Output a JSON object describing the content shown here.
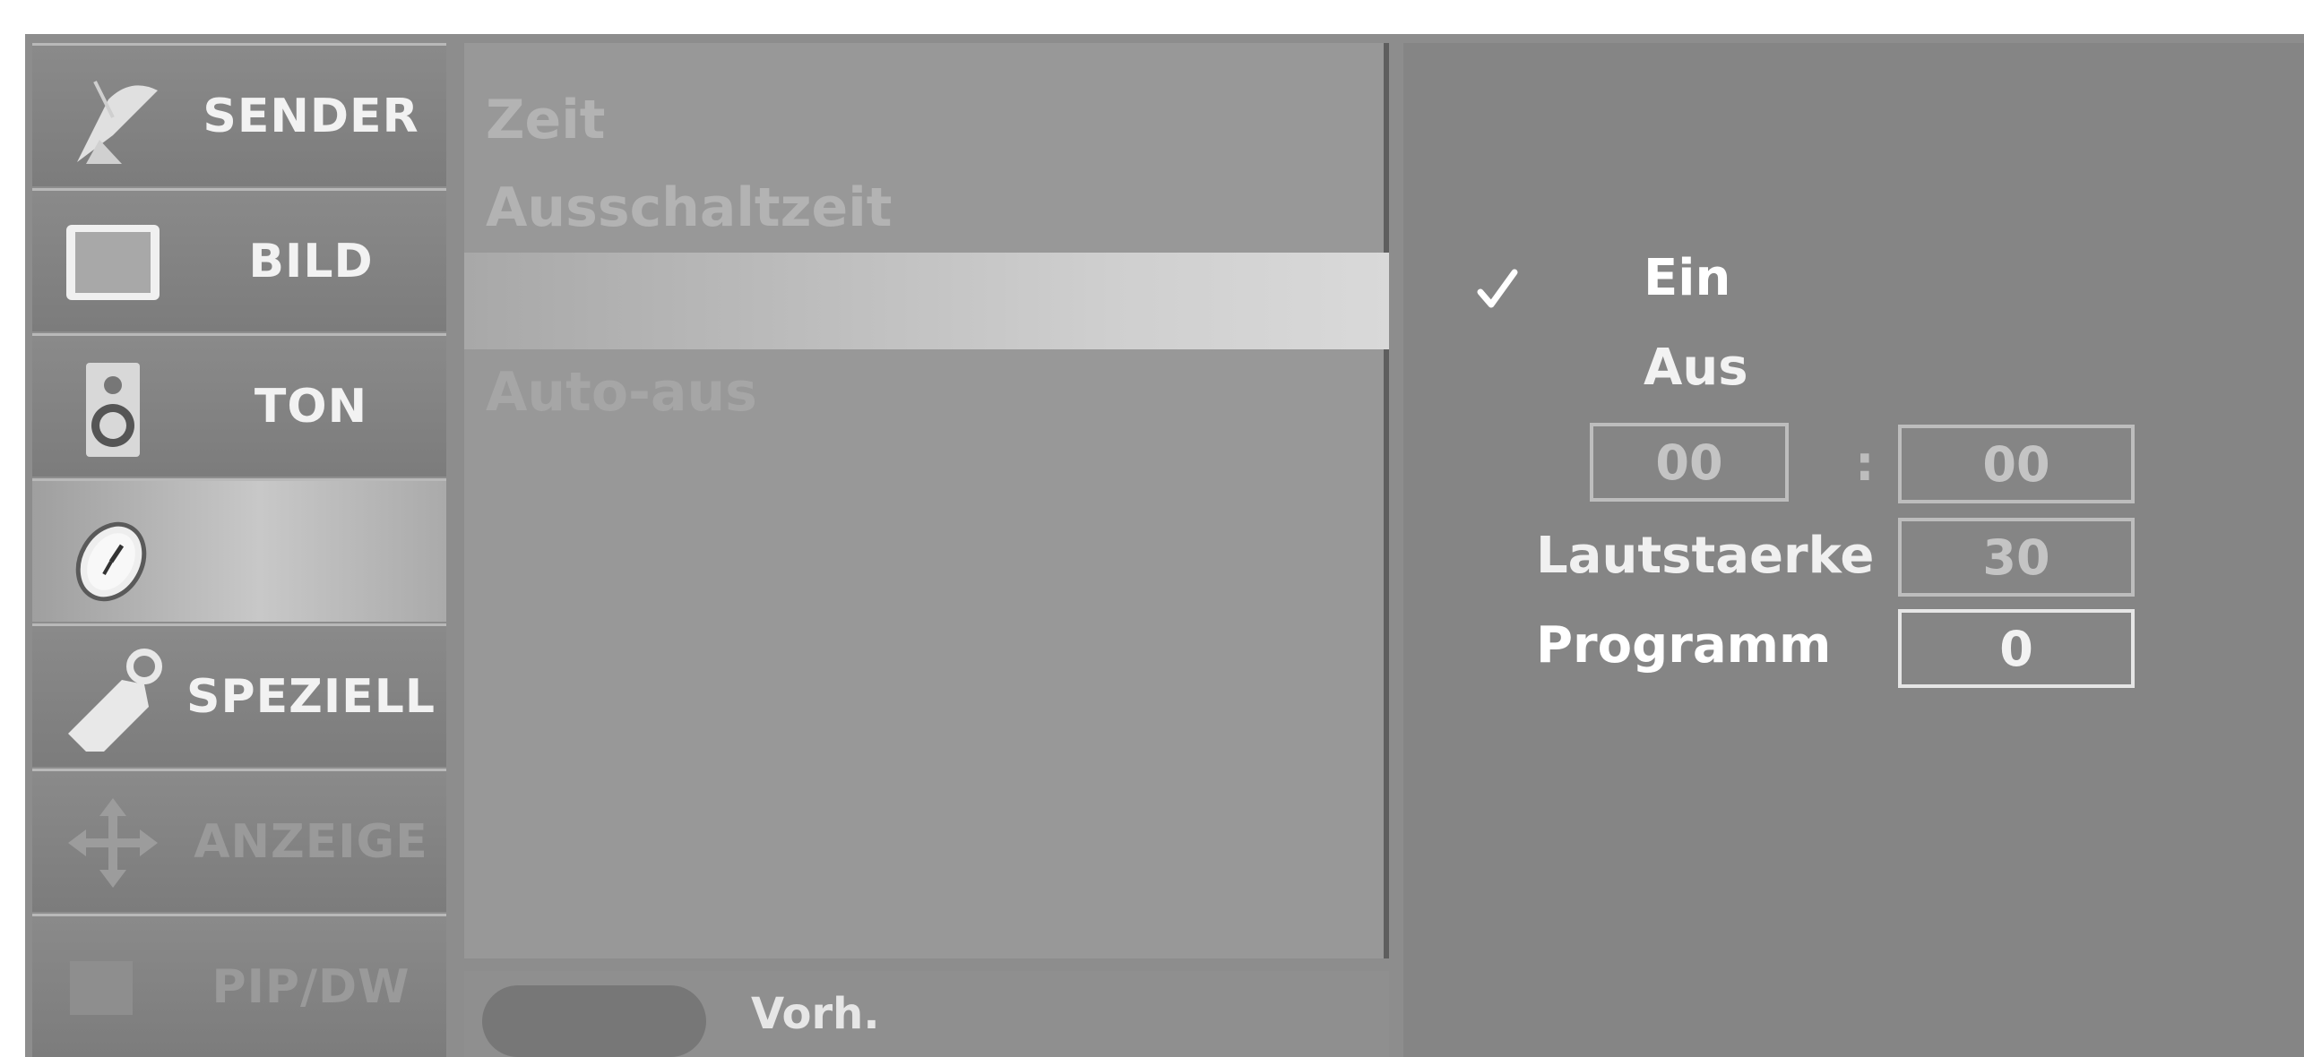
{
  "sidebar": {
    "items": [
      {
        "label": "SENDER"
      },
      {
        "label": "BILD"
      },
      {
        "label": "TON"
      },
      {
        "label": ""
      },
      {
        "label": "SPEZIELL"
      },
      {
        "label": "ANZEIGE"
      },
      {
        "label": "PIP/DW"
      }
    ]
  },
  "middle": {
    "items": [
      {
        "label": "Zeit"
      },
      {
        "label": "Ausschaltzeit"
      },
      {
        "label": ""
      },
      {
        "label": "Auto-aus"
      }
    ],
    "bottom_label": "Vorh."
  },
  "right": {
    "on_label": "Ein",
    "off_label": "Aus",
    "hour": "00",
    "separator": ":",
    "minute": "00",
    "volume_label": "Lautstaerke",
    "volume_value": "30",
    "program_label": "Programm",
    "program_value": "0"
  }
}
